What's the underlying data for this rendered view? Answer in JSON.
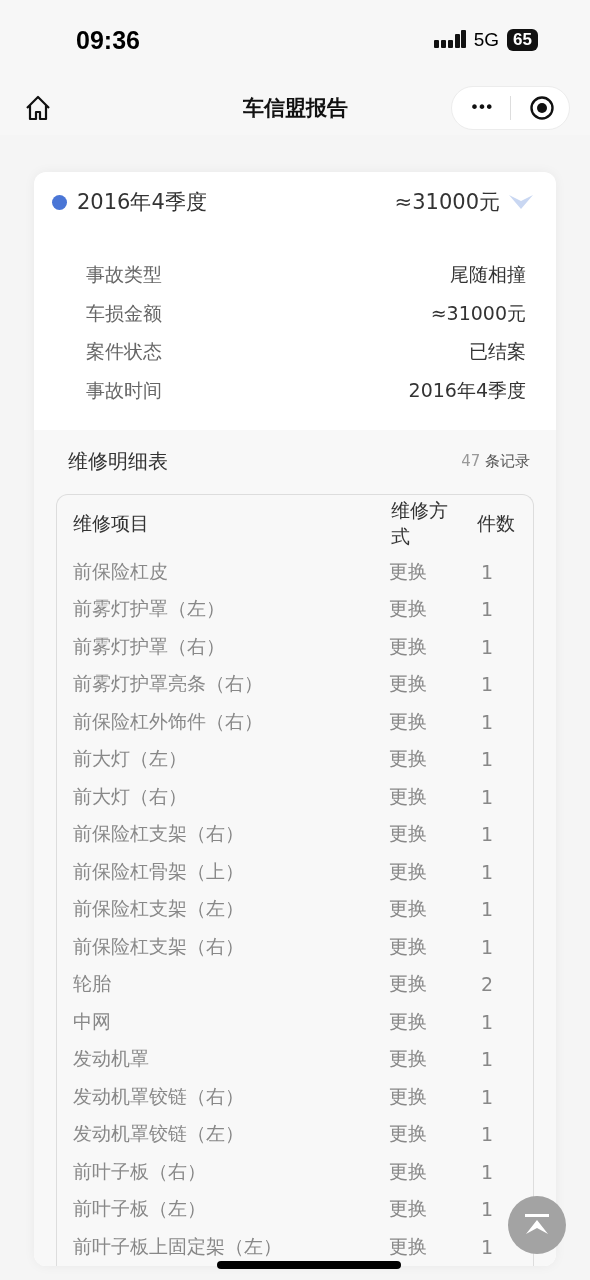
{
  "status_bar": {
    "time": "09:36",
    "network": "5G",
    "battery": "65"
  },
  "nav": {
    "title": "车信盟报告",
    "more": "•••"
  },
  "record": {
    "period": "2016年4季度",
    "amount": "≈31000元",
    "expanded": true,
    "color": "#4a76d6",
    "details": [
      {
        "label": "事故类型",
        "value": "尾随相撞"
      },
      {
        "label": "车损金额",
        "value": "≈31000元"
      },
      {
        "label": "案件状态",
        "value": "已结案"
      },
      {
        "label": "事故时间",
        "value": "2016年4季度"
      }
    ]
  },
  "repair": {
    "title": "维修明细表",
    "count": "47",
    "count_unit": "条记录",
    "columns": [
      "维修项目",
      "维修方式",
      "件数"
    ],
    "rows": [
      [
        "前保险杠皮",
        "更换",
        "1"
      ],
      [
        "前雾灯护罩（左）",
        "更换",
        "1"
      ],
      [
        "前雾灯护罩（右）",
        "更换",
        "1"
      ],
      [
        "前雾灯护罩亮条（右）",
        "更换",
        "1"
      ],
      [
        "前保险杠外饰件（右）",
        "更换",
        "1"
      ],
      [
        "前大灯（左）",
        "更换",
        "1"
      ],
      [
        "前大灯（右）",
        "更换",
        "1"
      ],
      [
        "前保险杠支架（右）",
        "更换",
        "1"
      ],
      [
        "前保险杠骨架（上）",
        "更换",
        "1"
      ],
      [
        "前保险杠支架（左）",
        "更换",
        "1"
      ],
      [
        "前保险杠支架（右）",
        "更换",
        "1"
      ],
      [
        "轮胎",
        "更换",
        "2"
      ],
      [
        "中网",
        "更换",
        "1"
      ],
      [
        "发动机罩",
        "更换",
        "1"
      ],
      [
        "发动机罩铰链（右）",
        "更换",
        "1"
      ],
      [
        "发动机罩铰链（左）",
        "更换",
        "1"
      ],
      [
        "前叶子板（右）",
        "更换",
        "1"
      ],
      [
        "前叶子板（左）",
        "更换",
        "1"
      ],
      [
        "前叶子板上固定架（左）",
        "更换",
        "1"
      ]
    ]
  }
}
